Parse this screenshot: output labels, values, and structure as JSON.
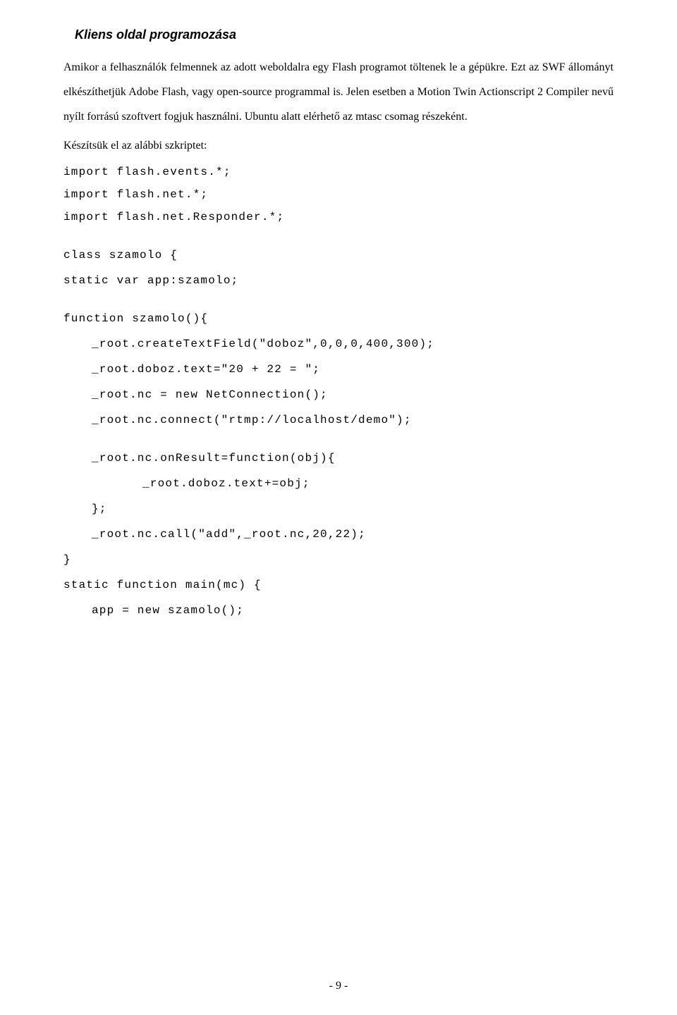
{
  "heading": "Kliens oldal programozása",
  "para1": "Amikor a felhasználók felmennek az adott weboldalra egy Flash programot töltenek le a gépükre. Ezt az SWF állományt elkészíthetjük Adobe Flash, vagy open-source programmal is. Jelen esetben a Motion Twin Actionscript 2 Compiler nevű nyílt forrású szoftvert fogjuk használni. Ubuntu alatt elérhető az mtasc csomag részeként.",
  "intro": "Készítsük el az alábbi szkriptet:",
  "code": {
    "imports": "import flash.events.*;\nimport flash.net.*;\nimport flash.net.Responder.*;",
    "classOpen": "class szamolo {",
    "staticVar": "static var app:szamolo;",
    "fnOpen": "function szamolo(){",
    "body1": "_root.createTextField(\"doboz\",0,0,0,400,300);",
    "body2": "_root.doboz.text=\"20 + 22 = \";",
    "body3": "_root.nc = new NetConnection();",
    "body4": "_root.nc.connect(\"rtmp://localhost/demo\");",
    "onResOpen": "_root.nc.onResult=function(obj){",
    "onResBody": "_root.doboz.text+=obj;",
    "onResClose": "};",
    "call": "_root.nc.call(\"add\",_root.nc,20,22);",
    "fnClose": "}",
    "mainOpen": "static function main(mc) {",
    "mainBody": "app = new szamolo();"
  },
  "footer": "- 9 -"
}
